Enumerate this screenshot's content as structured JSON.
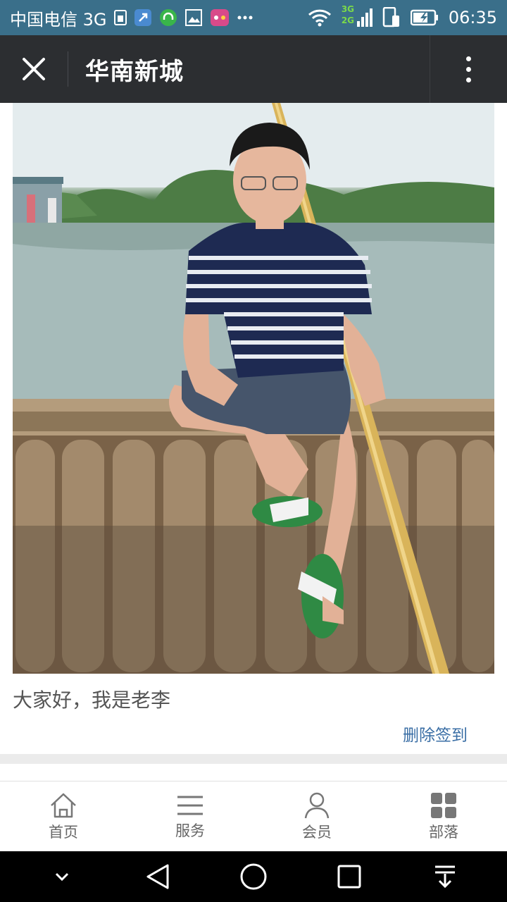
{
  "status_bar": {
    "carrier": "中国电信 3G",
    "network_badge_top": "3G",
    "network_badge_bottom": "2G",
    "time": "06:35",
    "icons": [
      "sim-icon",
      "bluetooth-app-icon",
      "headset-icon",
      "gallery-icon",
      "game-icon",
      "more-notifications-icon",
      "wifi-icon",
      "signal-icon",
      "phone-icon",
      "battery-icon"
    ]
  },
  "header": {
    "title": "华南新城",
    "close_icon": "close-icon",
    "more_icon": "more-vertical-icon"
  },
  "post": {
    "photo_description_icon": "photo-image",
    "text": "大家好，我是老李",
    "delete_label": "删除签到"
  },
  "tabs": [
    {
      "label": "首页",
      "icon": "home-icon"
    },
    {
      "label": "服务",
      "icon": "menu-list-icon"
    },
    {
      "label": "会员",
      "icon": "person-icon"
    },
    {
      "label": "部落",
      "icon": "grid-icon"
    }
  ],
  "nav_bar": {
    "icons": [
      "chevron-down-icon",
      "back-triangle-icon",
      "home-circle-icon",
      "recents-square-icon",
      "pull-down-icon"
    ]
  },
  "colors": {
    "status_bar": "#3a6f8a",
    "header": "#2c2e31",
    "link": "#3a6ea5",
    "nav_bar": "#000000"
  }
}
